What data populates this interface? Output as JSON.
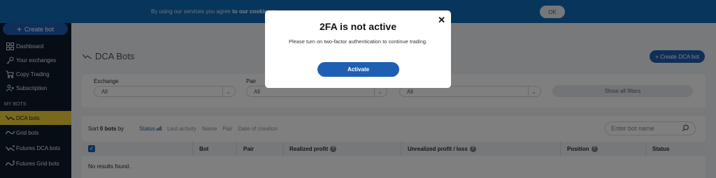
{
  "cookie_banner": {
    "text": "By using our services you agree ",
    "link": "to our cookies p",
    "ok_label": "OK"
  },
  "sidebar": {
    "create_bot_label": "Create bot",
    "items": [
      {
        "label": "Dashboard",
        "icon": "dashboard-icon"
      },
      {
        "label": "Your exchanges",
        "icon": "key-icon"
      },
      {
        "label": "Copy Trading",
        "icon": "cart-icon"
      },
      {
        "label": "Subscription",
        "icon": "subscription-icon"
      }
    ],
    "section_heading": "MY BOTS",
    "bot_items": [
      {
        "label": "DCA bots",
        "icon": "dca-icon",
        "active": true
      },
      {
        "label": "Grid bots",
        "icon": "grid-icon",
        "active": false
      },
      {
        "label": "Futures DCA bots",
        "icon": "futures-dca-icon",
        "active": false
      },
      {
        "label": "Futures Grid bots",
        "icon": "futures-grid-icon",
        "active": false
      }
    ]
  },
  "main": {
    "title": "DCA Bots",
    "create_dca_label": "+ Create DCA bot",
    "filters": {
      "exchange_label": "Exchange",
      "exchange_value": "All",
      "pair_label": "Pair",
      "pair_value": "All",
      "third_value": "All",
      "show_all_label": "Show all filters"
    },
    "sort": {
      "prefix": "Sort",
      "count": "0 bots",
      "suffix": "by",
      "options": [
        "Status",
        "Last activity",
        "Name",
        "Pair",
        "Date of creation"
      ],
      "active": "Status"
    },
    "search_placeholder": "Enter bot name",
    "columns": [
      "Bot",
      "Pair",
      "Realized profit",
      "Unrealized profit / loss",
      "Position",
      "Status"
    ],
    "empty_text": "No results found."
  },
  "modal": {
    "title": "2FA is not active",
    "message": "Please turn on two-factor authentication to continue trading.",
    "button_label": "Activate",
    "close_symbol": "✕"
  },
  "colors": {
    "brand_blue": "#1f5fb3",
    "active_nav": "#f5d33a",
    "sidebar_bg": "#0d1b2a",
    "banner_bg": "#0e6ab8"
  }
}
